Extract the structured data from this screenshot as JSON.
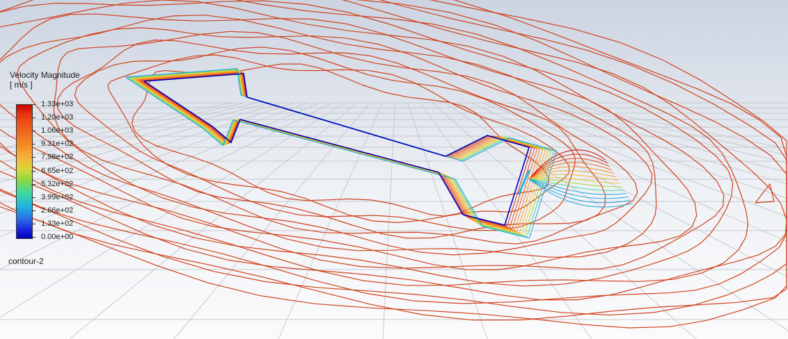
{
  "legend": {
    "title": "Velocity Magnitude",
    "unit": "[ m/s ]",
    "ticks": [
      "1.33e+03",
      "1.20e+03",
      "1.06e+03",
      "9.31e+02",
      "7.98e+02",
      "6.65e+02",
      "5.32e+02",
      "3.99e+02",
      "2.66e+02",
      "1.33e+02",
      "0.00e+00"
    ]
  },
  "contour_name": "contour-2",
  "colors": {
    "contour_outer": "#d0401a",
    "contour_max": "#c80000",
    "contour_min": "#0000b8",
    "grid": "#c6c9ce"
  }
}
